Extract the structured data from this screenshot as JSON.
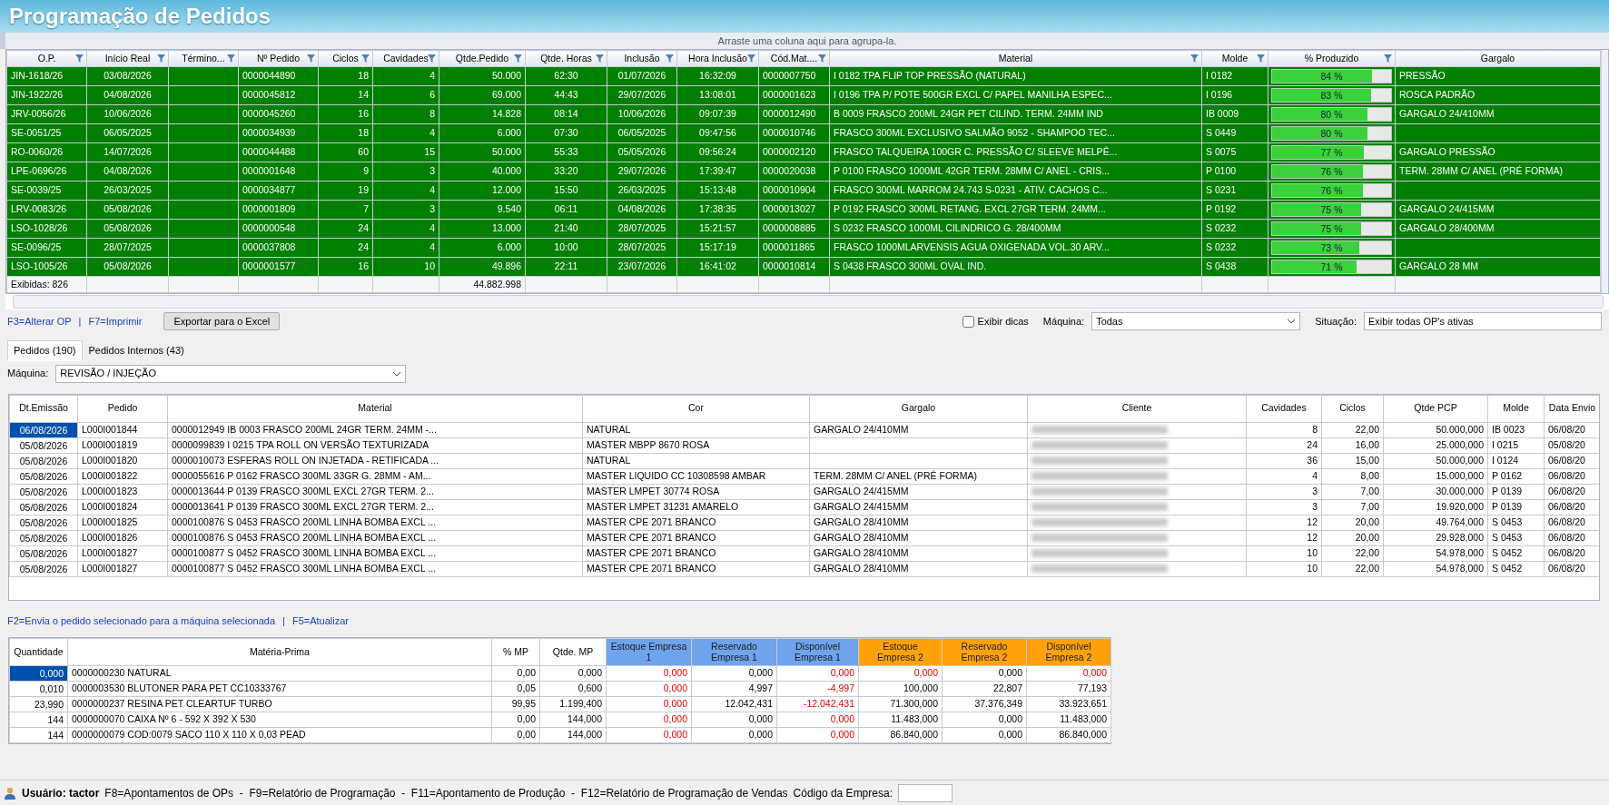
{
  "window": {
    "title": "Programação de Pedidos"
  },
  "group_panel": {
    "hint": "Arraste uma coluna aqui para agrupa-la."
  },
  "op_grid": {
    "columns": [
      {
        "label": "O.P.",
        "filter": true
      },
      {
        "label": "Início Real",
        "filter": true
      },
      {
        "label": "Término...",
        "filter": true
      },
      {
        "label": "Nº Pedido",
        "filter": true
      },
      {
        "label": "Ciclos",
        "filter": true
      },
      {
        "label": "Cavidades",
        "filter": true
      },
      {
        "label": "Qtde.Pedido",
        "filter": true
      },
      {
        "label": "Qtde. Horas",
        "filter": true
      },
      {
        "label": "Inclusão",
        "filter": true
      },
      {
        "label": "Hora Inclusão",
        "filter": true
      },
      {
        "label": "Cód.Mat....",
        "filter": true
      },
      {
        "label": "Material",
        "filter": true
      },
      {
        "label": "Molde",
        "filter": true
      },
      {
        "label": "% Produzido",
        "filter": true
      },
      {
        "label": "Gargalo",
        "filter": false
      }
    ],
    "rows": [
      {
        "op": "JIN-1618/26",
        "inicio_real": "03/08/2026",
        "n_pedido": "0000044890",
        "ciclos": "18",
        "cavidades": "4",
        "qtde_pedido": "50.000",
        "qtde_horas": "62:30",
        "inclusao": "01/07/2026",
        "hora_inclusao": "16:32:09",
        "cod_mat": "0000007750",
        "material": "I 0182 TPA FLIP TOP PRESSÃO (NATURAL)",
        "molde": "I 0182",
        "produzido": {
          "text": "84 %",
          "level": 0.84
        },
        "gargalo": "PRESSÃO"
      },
      {
        "op": "JIN-1922/26",
        "inicio_real": "04/08/2026",
        "n_pedido": "0000045812",
        "ciclos": "14",
        "cavidades": "6",
        "qtde_pedido": "69.000",
        "qtde_horas": "44:43",
        "inclusao": "29/07/2026",
        "hora_inclusao": "13:08:01",
        "cod_mat": "0000001623",
        "material": "I 0196 TPA P/ POTE 500GR EXCL C/ PAPEL MANILHA ESPEC...",
        "molde": "I 0196",
        "produzido": {
          "text": "83 %",
          "level": 0.83
        },
        "gargalo": "ROSCA PADRÃO"
      },
      {
        "op": "JRV-0056/26",
        "inicio_real": "10/06/2026",
        "n_pedido": "0000045260",
        "ciclos": "16",
        "cavidades": "8",
        "qtde_pedido": "14.828",
        "qtde_horas": "08:14",
        "inclusao": "10/06/2026",
        "hora_inclusao": "09:07:39",
        "cod_mat": "0000012490",
        "material": "B 0009 FRASCO 200ML 24GR PET CILIND. TERM. 24MM IND",
        "molde": "IB 0009",
        "produzido": {
          "text": "80 %",
          "level": 0.8
        },
        "gargalo": "GARGALO 24/410MM"
      },
      {
        "op": "SE-0051/25",
        "inicio_real": "06/05/2025",
        "n_pedido": "0000034939",
        "ciclos": "18",
        "cavidades": "4",
        "qtde_pedido": "6.000",
        "qtde_horas": "07:30",
        "inclusao": "06/05/2025",
        "hora_inclusao": "09:47:56",
        "cod_mat": "0000010746",
        "material": "FRASCO 300ML EXCLUSIVO SALMÃO 9052 - SHAMPOO TEC...",
        "molde": "S 0449",
        "produzido": {
          "text": "80 %",
          "level": 0.8
        }
      },
      {
        "op": "RO-0060/26",
        "inicio_real": "14/07/2026",
        "n_pedido": "0000044488",
        "ciclos": "60",
        "cavidades": "15",
        "qtde_pedido": "50.000",
        "qtde_horas": "55:33",
        "inclusao": "05/05/2026",
        "hora_inclusao": "09:56:24",
        "cod_mat": "0000002120",
        "material": "FRASCO TALQUEIRA 100GR C. PRESSÃO C/ SLEEVE MELPÊ...",
        "molde": "S 0075",
        "produzido": {
          "text": "77 %",
          "level": 0.77
        },
        "gargalo": "GARGALO PRESSÃO"
      },
      {
        "op": "LPE-0696/26",
        "inicio_real": "04/08/2026",
        "n_pedido": "0000001648",
        "ciclos": "9",
        "cavidades": "3",
        "qtde_pedido": "40.000",
        "qtde_horas": "33:20",
        "inclusao": "29/07/2026",
        "hora_inclusao": "17:39:47",
        "cod_mat": "0000020038",
        "material": "P 0100 FRASCO 1000ML 42GR TERM. 28MM C/ ANEL - CRIS...",
        "molde": "P 0100",
        "produzido": {
          "text": "76 %",
          "level": 0.76
        },
        "gargalo": "TERM. 28MM C/ ANEL (PRÉ FORMA)"
      },
      {
        "op": "SE-0039/25",
        "inicio_real": "26/03/2025",
        "n_pedido": "0000034877",
        "ciclos": "19",
        "cavidades": "4",
        "qtde_pedido": "12.000",
        "qtde_horas": "15:50",
        "inclusao": "26/03/2025",
        "hora_inclusao": "15:13:48",
        "cod_mat": "0000010904",
        "material": "FRASCO 300ML MARROM 24.743 S-0231 - ATIV. CACHOS C...",
        "molde": "S 0231",
        "produzido": {
          "text": "76 %",
          "level": 0.76
        }
      },
      {
        "op": "LRV-0083/26",
        "inicio_real": "05/08/2026",
        "n_pedido": "0000001809",
        "ciclos": "7",
        "cavidades": "3",
        "qtde_pedido": "9.540",
        "qtde_horas": "06:11",
        "inclusao": "04/08/2026",
        "hora_inclusao": "17:38:35",
        "cod_mat": "0000013027",
        "material": "P 0192 FRASCO 300ML RETANG. EXCL 27GR TERM. 24MM...",
        "molde": "P 0192",
        "produzido": {
          "text": "75 %",
          "level": 0.75
        },
        "gargalo": "GARGALO 24/415MM"
      },
      {
        "op": "LSO-1028/26",
        "inicio_real": "05/08/2026",
        "n_pedido": "0000000548",
        "ciclos": "24",
        "cavidades": "4",
        "qtde_pedido": "13.000",
        "qtde_horas": "21:40",
        "inclusao": "28/07/2025",
        "hora_inclusao": "15:21:57",
        "cod_mat": "0000008885",
        "material": "S 0232 FRASCO 1000ML CILINDRICO G. 28/400MM",
        "molde": "S 0232",
        "produzido": {
          "text": "75 %",
          "level": 0.75
        },
        "gargalo": "GARGALO 28/400MM"
      },
      {
        "op": "SE-0096/25",
        "inicio_real": "28/07/2025",
        "n_pedido": "0000037808",
        "ciclos": "24",
        "cavidades": "4",
        "qtde_pedido": "6.000",
        "qtde_horas": "10:00",
        "inclusao": "28/07/2025",
        "hora_inclusao": "15:17:19",
        "cod_mat": "0000011865",
        "material": "FRASCO 1000MLARVENSIS AGUA OXIGENADA VOL.30 ARV...",
        "molde": "S 0232",
        "produzido": {
          "text": "73 %",
          "level": 0.73
        }
      },
      {
        "op": "LSO-1005/26",
        "inicio_real": "05/08/2026",
        "n_pedido": "0000001577",
        "ciclos": "16",
        "cavidades": "10",
        "qtde_pedido": "49.896",
        "qtde_horas": "22:11",
        "inclusao": "23/07/2026",
        "hora_inclusao": "16:41:02",
        "cod_mat": "0000010814",
        "material": "S 0438 FRASCO 300ML OVAL IND.",
        "molde": "S 0438",
        "produzido": {
          "text": "71 %",
          "level": 0.71
        },
        "gargalo": "GARGALO 28 MM"
      }
    ],
    "footer": {
      "count": "Exibidas: 826",
      "qtde_pedido_total": "44.882.998"
    }
  },
  "toolbar": {
    "shortcuts": [
      "F3=Alterar OP",
      "|",
      "F7=Imprimir"
    ],
    "export_button": "Exportar para o Excel",
    "tips_checkbox": {
      "label": "Exibir dicas",
      "checked": false
    },
    "machine_filter": {
      "label": "Máquina:",
      "value": "Todas"
    },
    "status_filter": {
      "label": "Situação:",
      "value": "Exibir todas OP's ativas"
    }
  },
  "tabs": [
    {
      "label": "Pedidos (190)",
      "selected": true
    },
    {
      "label": "Pedidos Internos (43)",
      "selected": false
    }
  ],
  "machine_select": {
    "label": "Máquina:",
    "value": "REVISÃO / INJEÇÃO"
  },
  "orders_grid": {
    "columns": [
      "Dt.Emissão",
      "Pedido",
      "Material",
      "Cor",
      "Gargalo",
      "Cliente",
      "Cavidades",
      "Ciclos",
      "Qtde PCP",
      "Molde",
      "Data Envio"
    ],
    "rows": [
      {
        "selected": true,
        "dt_emissao": "06/08/2026",
        "pedido": "L000I001844",
        "material": "0000012949 IB 0003 FRASCO 200ML 24GR TERM. 24MM -...",
        "cor": "NATURAL",
        "gargalo": "GARGALO 24/410MM",
        "cliente_blurred": true,
        "cavidades": "8",
        "ciclos": "22,00",
        "qtde_pcp": "50.000,000",
        "molde": "IB 0023",
        "data_envio": "06/08/20"
      },
      {
        "selected": false,
        "dt_emissao": "05/08/2026",
        "pedido": "L000I001819",
        "material": "0000099839 I 0215 TPA ROLL ON VERSÃO TEXTURIZADA",
        "cor": "MASTER MBPP 8670 ROSA",
        "cliente_blurred": true,
        "cavidades": "24",
        "ciclos": "16,00",
        "qtde_pcp": "25.000,000",
        "molde": "I 0215",
        "data_envio": "05/08/20"
      },
      {
        "selected": false,
        "dt_emissao": "05/08/2026",
        "pedido": "L000I001820",
        "material": "0000010073 ESFERAS ROLL ON INJETADA - RETIFICADA ...",
        "cor": "NATURAL",
        "cliente_blurred": true,
        "cavidades": "36",
        "ciclos": "15,00",
        "qtde_pcp": "50.000,000",
        "molde": "I 0124",
        "data_envio": "06/08/20"
      },
      {
        "selected": false,
        "dt_emissao": "05/08/2026",
        "pedido": "L000I001822",
        "material": "0000055616 P 0162 FRASCO 300ML 33GR G. 28MM - AM...",
        "cor": "MASTER LIQUIDO CC 10308598 AMBAR",
        "gargalo": "TERM. 28MM C/ ANEL (PRÉ FORMA)",
        "cliente_blurred": true,
        "cavidades": "4",
        "ciclos": "8,00",
        "qtde_pcp": "15.000,000",
        "molde": "P 0162",
        "data_envio": "06/08/20"
      },
      {
        "selected": false,
        "dt_emissao": "05/08/2026",
        "pedido": "L000I001823",
        "material": "0000013644 P 0139 FRASCO 300ML EXCL 27GR TERM. 2...",
        "cor": "MASTER LMPET 30774 ROSA",
        "gargalo": "GARGALO 24/415MM",
        "cliente_blurred": true,
        "cavidades": "3",
        "ciclos": "7,00",
        "qtde_pcp": "30.000,000",
        "molde": "P 0139",
        "data_envio": "06/08/20"
      },
      {
        "selected": false,
        "dt_emissao": "05/08/2026",
        "pedido": "L000I001824",
        "material": "0000013641 P 0139 FRASCO 300ML EXCL 27GR TERM. 2...",
        "cor": "MASTER LMPET 31231 AMARELO",
        "gargalo": "GARGALO 24/415MM",
        "cliente_blurred": true,
        "cavidades": "3",
        "ciclos": "7,00",
        "qtde_pcp": "19.920,000",
        "molde": "P 0139",
        "data_envio": "06/08/20"
      },
      {
        "selected": false,
        "dt_emissao": "05/08/2026",
        "pedido": "L000I001825",
        "material": "0000100876 S 0453 FRASCO 200ML LINHA BOMBA EXCL ...",
        "cor": "MASTER CPE 2071 BRANCO",
        "gargalo": "GARGALO 28/410MM",
        "cliente_blurred": true,
        "cavidades": "12",
        "ciclos": "20,00",
        "qtde_pcp": "49.764,000",
        "molde": "S 0453",
        "data_envio": "06/08/20"
      },
      {
        "selected": false,
        "dt_emissao": "05/08/2026",
        "pedido": "L000I001826",
        "material": "0000100876 S 0453 FRASCO 200ML LINHA BOMBA EXCL ...",
        "cor": "MASTER CPE 2071 BRANCO",
        "gargalo": "GARGALO 28/410MM",
        "cliente_blurred": true,
        "cavidades": "12",
        "ciclos": "20,00",
        "qtde_pcp": "29.928,000",
        "molde": "S 0453",
        "data_envio": "06/08/20"
      },
      {
        "selected": false,
        "dt_emissao": "05/08/2026",
        "pedido": "L000I001827",
        "material": "0000100877 S 0452 FRASCO 300ML LINHA BOMBA EXCL ...",
        "cor": "MASTER CPE 2071 BRANCO",
        "gargalo": "GARGALO 28/410MM",
        "cliente_blurred": true,
        "cavidades": "10",
        "ciclos": "22,00",
        "qtde_pcp": "54.978,000",
        "molde": "S 0452",
        "data_envio": "06/08/20"
      },
      {
        "selected": false,
        "dt_emissao": "05/08/2026",
        "pedido": "L000I001827",
        "material": "0000100877 S 0452 FRASCO 300ML LINHA BOMBA EXCL ...",
        "cor": "MASTER CPE 2071 BRANCO",
        "gargalo": "GARGALO 28/410MM",
        "cliente_blurred": true,
        "cavidades": "10",
        "ciclos": "22,00",
        "qtde_pcp": "54.978,000",
        "molde": "S 0452",
        "data_envio": "06/08/20"
      }
    ]
  },
  "orders_hint": [
    "F2=Envia o pedido selecionado para a máquina selecionada",
    "|",
    "F5=Atualizar"
  ],
  "materials_grid": {
    "columns": [
      {
        "label": "Quantidade"
      },
      {
        "label": "Matéria-Prima"
      },
      {
        "label": "% MP"
      },
      {
        "label": "Qtde. MP"
      },
      {
        "label": "Estoque Empresa 1",
        "color": "#6fa3ec"
      },
      {
        "label": "Reservado Empresa 1",
        "color": "#6fa3ec"
      },
      {
        "label": "Disponível Empresa 1",
        "color": "#6fa3ec"
      },
      {
        "label": "Estoque Empresa 2",
        "color": "#ffa20a"
      },
      {
        "label": "Reservado Empresa 2",
        "color": "#ffa20a"
      },
      {
        "label": "Disponível Empresa 2",
        "color": "#ffa20a"
      }
    ],
    "rows": [
      {
        "selected": true,
        "quantidade": "0,000",
        "materia_prima": "0000000230 NATURAL",
        "pct_mp": "0,00",
        "qtde_mp": "0,000",
        "stock": [
          {
            "text": "0,000",
            "alert": true
          },
          {
            "text": "0,000",
            "alert": false
          },
          {
            "text": "0,000",
            "alert": true
          },
          {
            "text": "0,000",
            "alert": true
          },
          {
            "text": "0,000",
            "alert": false
          },
          {
            "text": "0,000",
            "alert": true
          }
        ]
      },
      {
        "selected": false,
        "quantidade": "0,010",
        "materia_prima": "0000003530 BLUTONER PARA PET CC10333767",
        "pct_mp": "0,05",
        "qtde_mp": "0,600",
        "stock": [
          {
            "text": "0,000",
            "alert": true
          },
          {
            "text": "4,997",
            "alert": false
          },
          {
            "text": "-4,997",
            "alert": true
          },
          {
            "text": "100,000",
            "alert": false
          },
          {
            "text": "22,807",
            "alert": false
          },
          {
            "text": "77,193",
            "alert": false
          }
        ]
      },
      {
        "selected": false,
        "quantidade": "23,990",
        "materia_prima": "0000000237 RESINA PET CLEARTUF TURBO",
        "pct_mp": "99,95",
        "qtde_mp": "1.199,400",
        "stock": [
          {
            "text": "0,000",
            "alert": true
          },
          {
            "text": "12.042,431",
            "alert": false
          },
          {
            "text": "-12.042,431",
            "alert": true
          },
          {
            "text": "71.300,000",
            "alert": false
          },
          {
            "text": "37.376,349",
            "alert": false
          },
          {
            "text": "33.923,651",
            "alert": false
          }
        ]
      },
      {
        "selected": false,
        "quantidade": "144",
        "materia_prima": "0000000070 CAIXA Nº 6 - 592 X 392 X 530",
        "pct_mp": "0,00",
        "qtde_mp": "144,000",
        "stock": [
          {
            "text": "0,000",
            "alert": true
          },
          {
            "text": "0,000",
            "alert": false
          },
          {
            "text": "0,000",
            "alert": true
          },
          {
            "text": "11.483,000",
            "alert": false
          },
          {
            "text": "0,000",
            "alert": false
          },
          {
            "text": "11.483,000",
            "alert": false
          }
        ]
      },
      {
        "selected": false,
        "quantidade": "144",
        "materia_prima": "0000000079 COD:0079 SACO 110 X 110 X 0,03 PEAD",
        "pct_mp": "0,00",
        "qtde_mp": "144,000",
        "stock": [
          {
            "text": "0,000",
            "alert": true
          },
          {
            "text": "0,000",
            "alert": false
          },
          {
            "text": "0,000",
            "alert": true
          },
          {
            "text": "86.840,000",
            "alert": false
          },
          {
            "text": "0,000",
            "alert": false
          },
          {
            "text": "86.840,000",
            "alert": false
          }
        ]
      }
    ]
  },
  "status_bar": {
    "user": "Usuário: tactor",
    "shortcuts": "F8=Apontamentos de OPs  -  F9=Relatório de Programação  -  F11=Apontamento de Produção  -  F12=Relatório de Programação de Vendas",
    "company_label": "Código da Empresa:"
  }
}
